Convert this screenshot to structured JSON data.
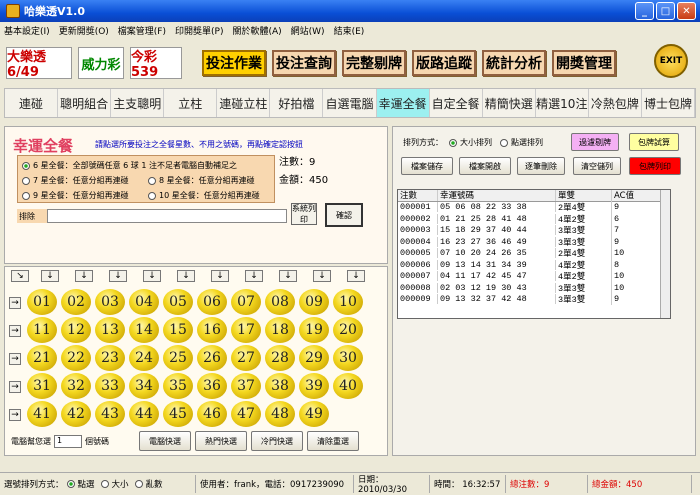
{
  "window": {
    "title": "哈樂透V1.0"
  },
  "menu": [
    "基本設定(I)",
    "更新開獎(O)",
    "檔案管理(F)",
    "印開獎單(P)",
    "關於軟體(A)",
    "網站(W)",
    "結束(E)"
  ],
  "logos": [
    "大樂透 6/49",
    "威力彩",
    "今彩539"
  ],
  "bigButtons": [
    "投注作業",
    "投注查詢",
    "完整剔牌",
    "版路追蹤",
    "統計分析",
    "開獎管理"
  ],
  "exit": "EXIT",
  "tabs": [
    "連碰",
    "聰明組合",
    "主支聰明",
    "立柱",
    "連碰立柱",
    "好拍檔",
    "自選電腦",
    "幸運全餐",
    "自定全餐",
    "精簡快選",
    "精選10注",
    "冷熱包牌",
    "博士包牌"
  ],
  "activeTab": "幸運全餐",
  "lucky": {
    "title": "幸運全餐",
    "instruction": "請點選所要投注之全餐星數、不用之號碼，再點確定認按鈕",
    "options": [
      "6 星全餐：全部號碼任意 6 球 1 注不足者電腦自動補足之",
      "7 星全餐：任意分組再連碰",
      "8 星全餐：任意分組再連碰",
      "9 星全餐：任意分組再連碰",
      "10 星全餐：任意分組再連碰"
    ],
    "bets": "注數：9",
    "amount": "金額：450",
    "exclude_label": "排除",
    "sys_print": "系統列印",
    "confirm": "確認"
  },
  "right": {
    "sort_label": "排列方式：",
    "sort_size": "大小排列",
    "sort_click": "點選排列",
    "btn_filter": "過濾剔牌",
    "btn_calc": "包牌試算",
    "btn_save": "檔案儲存",
    "btn_open": "檔案開啟",
    "btn_delete": "逐筆刪除",
    "btn_clear": "清空儲列",
    "btn_print": "包牌列印",
    "headers": [
      "注數",
      "幸運號碼",
      "單雙",
      "AC值"
    ],
    "rows": [
      [
        "000001",
        "05 06 08 22 33 38",
        "2單4雙",
        "9"
      ],
      [
        "000002",
        "01 21 25 28 41 48",
        "4單2雙",
        "6"
      ],
      [
        "000003",
        "15 18 29 37 40 44",
        "3單3雙",
        "7"
      ],
      [
        "000004",
        "16 23 27 36 46 49",
        "3單3雙",
        "9"
      ],
      [
        "000005",
        "07 10 20 24 26 35",
        "2單4雙",
        "10"
      ],
      [
        "000006",
        "09 13 14 31 34 39",
        "4單2雙",
        "8"
      ],
      [
        "000007",
        "04 11 17 42 45 47",
        "4單2雙",
        "10"
      ],
      [
        "000008",
        "02 03 12 19 30 43",
        "3單3雙",
        "10"
      ],
      [
        "000009",
        "09 13 32 37 42 48",
        "3單3雙",
        "9"
      ]
    ]
  },
  "balls": [
    "01",
    "02",
    "03",
    "04",
    "05",
    "06",
    "07",
    "08",
    "09",
    "10",
    "11",
    "12",
    "13",
    "14",
    "15",
    "16",
    "17",
    "18",
    "19",
    "20",
    "21",
    "22",
    "23",
    "24",
    "25",
    "26",
    "27",
    "28",
    "29",
    "30",
    "31",
    "32",
    "33",
    "34",
    "35",
    "36",
    "37",
    "38",
    "39",
    "40",
    "41",
    "42",
    "43",
    "44",
    "45",
    "46",
    "47",
    "48",
    "49"
  ],
  "bottom": {
    "pick_label": "電腦幫您選",
    "pick_value": "1",
    "pick_unit": "個號碼",
    "btn_quick": "電腦快選",
    "btn_hot": "熱門快選",
    "btn_cold": "冷門快選",
    "btn_clear": "清除重選"
  },
  "status": {
    "order_label": "選號排列方式：",
    "order_click": "點選",
    "order_size": "大小",
    "order_random": "亂數",
    "user": "使用者：frank，電話：0917239090",
    "date": "日期： 2010/03/30",
    "time": "時間： 16:32:57",
    "total_bets": "總注數：9",
    "total_amount": "總金額：450"
  }
}
